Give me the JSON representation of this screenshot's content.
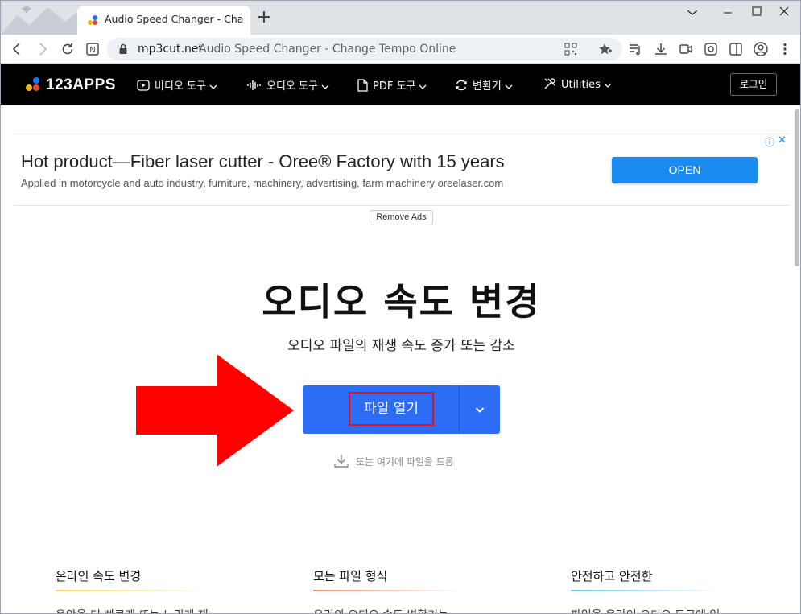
{
  "browser": {
    "tab_title": "Audio Speed Changer - Change Tempo Online",
    "new_tab": "+",
    "url_host": "mp3cut.net",
    "url_page_title": "Audio Speed Changer - Change Tempo Online"
  },
  "site_nav": {
    "logo": "123APPS",
    "items": [
      {
        "label": "비디오 도구",
        "icon": "play-icon"
      },
      {
        "label": "오디오 도구",
        "icon": "waveform-icon"
      },
      {
        "label": "PDF 도구",
        "icon": "document-icon"
      },
      {
        "label": "변환기",
        "icon": "convert-icon"
      },
      {
        "label": "Utilities",
        "icon": "tools-icon"
      }
    ],
    "login": "로그인"
  },
  "ad": {
    "title": "Hot product—Fiber laser cutter - Oree® Factory with 15 years",
    "subtitle": "Applied in motorcycle and auto industry, furniture, machinery, advertising, farm machinery oreelaser.com",
    "button": "OPEN",
    "info": "ⓘ",
    "close": "✕",
    "remove": "Remove Ads"
  },
  "main": {
    "title": "오디오 속도 변경",
    "subtitle": "오디오 파일의 재생 속도 증가 또는 감소",
    "open_button": "파일 열기",
    "drop_hint": "또는 여기에 파일을 드롭"
  },
  "features": [
    {
      "title": "온라인 속도 변경",
      "text": "음악을 더 빠르게 또는 느리게 재",
      "color": "#f7d94c"
    },
    {
      "title": "모든 파일 형식",
      "text": "우리의 오디오 속도 변환기는",
      "color": "#f28b6a"
    },
    {
      "title": "안전하고 안전한",
      "text": "파일을 온라인 오디오 도구에 업",
      "color": "#5ec8e8"
    }
  ],
  "colors": {
    "accent_blue": "#2d6cf5",
    "highlight_red": "#e0121a",
    "arrow_red": "#ff0000"
  }
}
